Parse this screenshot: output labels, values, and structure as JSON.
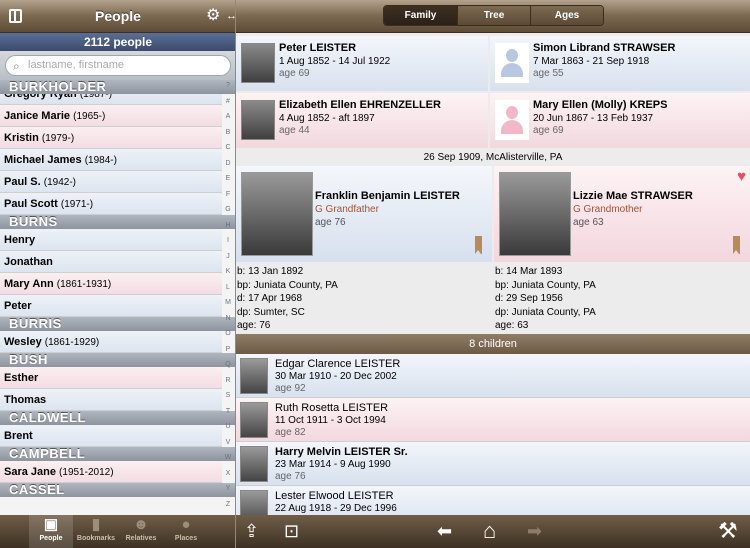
{
  "left_header": {
    "title": "People",
    "sidebar_icon": "sidebar-toggle-icon",
    "settings_icon": "gear-icon",
    "expand_icon": "expand-arrows-icon",
    "expand_glyph": "↔"
  },
  "people_count": "2112 people",
  "search": {
    "placeholder": "lastname, firstname"
  },
  "sections": [
    {
      "name": "BURKHOLDER",
      "rows": [
        {
          "name": "Gregory Ryan",
          "years": "(1987-)",
          "sex": "m"
        },
        {
          "name": "Janice Marie",
          "years": "(1965-)",
          "sex": "f"
        },
        {
          "name": "Kristin",
          "years": "(1979-)",
          "sex": "f"
        },
        {
          "name": "Michael James",
          "years": "(1984-)",
          "sex": "m"
        },
        {
          "name": "Paul S.",
          "years": "(1942-)",
          "sex": "m"
        },
        {
          "name": "Paul Scott",
          "years": "(1971-)",
          "sex": "m"
        }
      ]
    },
    {
      "name": "BURNS",
      "rows": [
        {
          "name": "Henry",
          "years": "",
          "sex": "m"
        },
        {
          "name": "Jonathan",
          "years": "",
          "sex": "m"
        },
        {
          "name": "Mary Ann",
          "years": "(1861-1931)",
          "sex": "f"
        },
        {
          "name": "Peter",
          "years": "",
          "sex": "m"
        }
      ]
    },
    {
      "name": "BURRIS",
      "rows": [
        {
          "name": "Wesley",
          "years": "(1861-1929)",
          "sex": "m"
        }
      ]
    },
    {
      "name": "BUSH",
      "rows": [
        {
          "name": "Esther",
          "years": "",
          "sex": "f"
        },
        {
          "name": "Thomas",
          "years": "",
          "sex": "m"
        }
      ]
    },
    {
      "name": "CALDWELL",
      "rows": [
        {
          "name": "Brent",
          "years": "",
          "sex": "m"
        }
      ]
    },
    {
      "name": "CAMPBELL",
      "rows": [
        {
          "name": "Sara Jane",
          "years": "(1951-2012)",
          "sex": "f"
        }
      ]
    },
    {
      "name": "CASSEL",
      "rows": []
    }
  ],
  "index_letters": [
    "?",
    "#",
    "A",
    "B",
    "C",
    "D",
    "E",
    "F",
    "G",
    "H",
    "I",
    "J",
    "K",
    "L",
    "M",
    "N",
    "O",
    "P",
    "Q",
    "R",
    "S",
    "T",
    "U",
    "V",
    "W",
    "X",
    "Y",
    "Z"
  ],
  "tabbar": [
    {
      "label": "People",
      "icon": "people-card-icon",
      "glyph": "▣",
      "selected": true
    },
    {
      "label": "Bookmarks",
      "icon": "bookmark-icon",
      "glyph": "▮",
      "selected": false
    },
    {
      "label": "Relatives",
      "icon": "relatives-icon",
      "glyph": "☻",
      "selected": false
    },
    {
      "label": "Places",
      "icon": "globe-icon",
      "glyph": "●",
      "selected": false
    }
  ],
  "view_tabs": [
    {
      "label": "Family",
      "selected": true
    },
    {
      "label": "Tree",
      "selected": false
    },
    {
      "label": "Ages",
      "selected": false
    }
  ],
  "grandparents": [
    {
      "name": "Peter LEISTER",
      "dates": "1 Aug 1852 - 14 Jul 1922",
      "age": "age 69",
      "sex": "m",
      "photo": true
    },
    {
      "name": "Simon Librand STRAWSER",
      "dates": "7 Mar 1863 - 21 Sep 1918",
      "age": "age 55",
      "sex": "m",
      "photo": false
    },
    {
      "name": "Elizabeth Ellen EHRENZELLER",
      "dates": "4 Aug 1852 - aft 1897",
      "age": "age 44",
      "sex": "f",
      "photo": true
    },
    {
      "name": "Mary Ellen (Molly) KREPS",
      "dates": "20 Jun 1867 - 13 Feb 1937",
      "age": "age 69",
      "sex": "f",
      "photo": false
    }
  ],
  "marriage": "26 Sep 1909, McAlisterville, PA",
  "father": {
    "name": "Franklin Benjamin LEISTER",
    "relation": "G Grandfather",
    "age": "age 76",
    "facts": [
      "b: 13 Jan 1892",
      "bp: Juniata County, PA",
      "d: 17 Apr 1968",
      "dp: Sumter, SC",
      "age: 76"
    ]
  },
  "mother": {
    "name": "Lizzie Mae STRAWSER",
    "relation": "G Grandmother",
    "age": "age 63",
    "facts": [
      "b: 14 Mar 1893",
      "bp: Juniata County, PA",
      "d: 29 Sep 1956",
      "dp: Juniata County, PA",
      "age: 63"
    ]
  },
  "children_header": "8 children",
  "children": [
    {
      "name": "Edgar Clarence LEISTER",
      "dates": "30 Mar 1910 - 20 Dec 2002",
      "age": "age 92",
      "sex": "m",
      "bold": false
    },
    {
      "name": "Ruth Rosetta LEISTER",
      "dates": "11 Oct 1911 - 3 Oct 1994",
      "age": "age 82",
      "sex": "f",
      "bold": false
    },
    {
      "name": "Harry Melvin LEISTER Sr.",
      "dates": "23 Mar 1914 - 9 Aug 1990",
      "age": "age 76",
      "sex": "m",
      "bold": true
    },
    {
      "name": "Lester Elwood LEISTER",
      "dates": "22 Aug 1918 - 29 Dec 1996",
      "age": "",
      "sex": "m",
      "bold": false
    }
  ],
  "toolbar": {
    "share": "share-icon",
    "present": "presentation-icon",
    "back": "back-arrow-icon",
    "home": "home-icon",
    "forward": "forward-arrow-icon",
    "tools": "hammer-icon",
    "share_glyph": "⇪",
    "present_glyph": "⊡",
    "back_glyph": "⬅",
    "home_glyph": "⌂",
    "forward_glyph": "➡",
    "tools_glyph": "⚒"
  }
}
